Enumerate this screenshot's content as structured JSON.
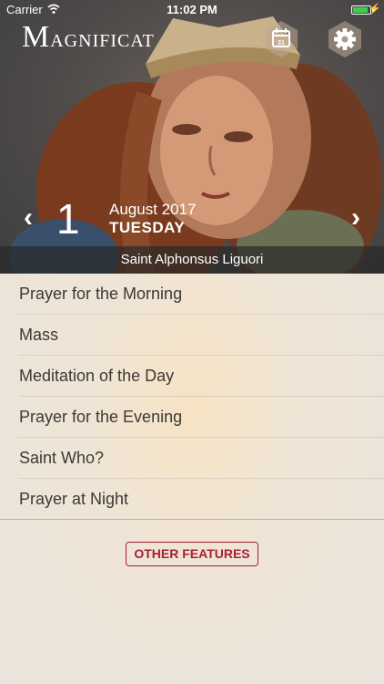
{
  "status_bar": {
    "carrier": "Carrier",
    "time": "11:02 PM",
    "battery_level": 0.9
  },
  "header": {
    "logo_initial": "M",
    "logo_rest": "AGNIFICAT",
    "calendar_day": "31",
    "calendar_icon": "calendar-icon",
    "settings_icon": "gear-icon"
  },
  "date": {
    "day": "1",
    "month_year": "August 2017",
    "weekday": "TUESDAY",
    "prev_icon": "chevron-left-icon",
    "next_icon": "chevron-right-icon"
  },
  "feast": "Saint Alphonsus Liguori",
  "menu": [
    {
      "label": "Prayer for the Morning"
    },
    {
      "label": "Mass"
    },
    {
      "label": "Meditation of the Day"
    },
    {
      "label": "Prayer for the Evening"
    },
    {
      "label": "Saint Who?"
    },
    {
      "label": "Prayer at Night"
    }
  ],
  "other_features_label": "OTHER FEATURES",
  "colors": {
    "accent": "#a81e36",
    "battery": "#3ccf48",
    "text": "#3b3936"
  }
}
